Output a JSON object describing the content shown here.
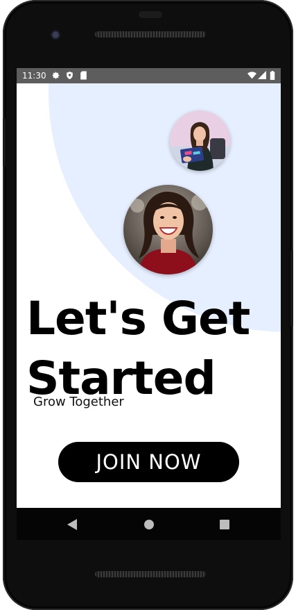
{
  "status_bar": {
    "time": "11:30",
    "left_icons": [
      "gear-icon",
      "shield-icon",
      "sd-card-icon"
    ],
    "right_icons": [
      "wifi-icon",
      "signal-icon",
      "battery-icon"
    ]
  },
  "hero": {
    "title_line1": "Let's Get",
    "title_line2": "Started",
    "subtitle": "Grow Together",
    "cta_label": "JOIN NOW"
  },
  "avatars": [
    {
      "name": "avatar-small",
      "description_icon": "woman-reading-icon"
    },
    {
      "name": "avatar-large",
      "description_icon": "woman-smiling-icon"
    }
  ],
  "nav": {
    "buttons": [
      "back-icon",
      "home-icon",
      "recents-icon"
    ]
  },
  "colors": {
    "accent_blob": "#e6efff",
    "button_bg": "#000000",
    "button_text": "#ffffff",
    "status_bar": "#5d5d5d"
  }
}
